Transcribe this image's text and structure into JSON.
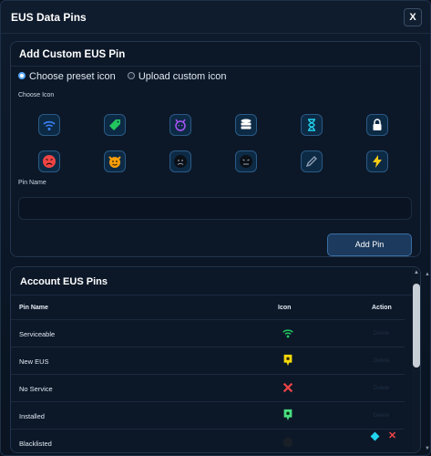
{
  "dialog": {
    "title": "EUS Data Pins",
    "close_label": "X"
  },
  "add_section": {
    "title": "Add Custom EUS Pin",
    "radio_preset": "Choose preset icon",
    "radio_upload": "Upload custom icon",
    "radio_selected": "preset",
    "choose_icon_label": "Choose Icon",
    "pin_name_label": "Pin Name",
    "pin_name_value": "",
    "add_button": "Add Pin",
    "icons": [
      "wifi-icon",
      "tag-icon",
      "devil-icon",
      "database-icon",
      "hourglass-icon",
      "lock-icon",
      "angry-face-icon",
      "cat-face-icon",
      "sad-face-icon",
      "frown-face-icon",
      "pencil-icon",
      "lightning-icon"
    ]
  },
  "list_section": {
    "title": "Account EUS Pins",
    "columns": {
      "name": "Pin Name",
      "icon": "Icon",
      "action": "Action"
    },
    "rows": [
      {
        "name": "Serviceable",
        "icon": "wifi-icon",
        "action": "Delete"
      },
      {
        "name": "New EUS",
        "icon": "pin-icon",
        "action": "Delete"
      },
      {
        "name": "No Service",
        "icon": "x-mark-icon",
        "action": "Delete"
      },
      {
        "name": "Installed",
        "icon": "pin-icon",
        "action": "Delete"
      },
      {
        "name": "Blacklisted",
        "icon": "pin-icon",
        "action": ""
      }
    ]
  },
  "colors": {
    "background": "#0a1220",
    "accent": "#3b6ea3",
    "wifi_green": "#22c55e",
    "yellow_pin": "#f5d90a",
    "red": "#ef4444",
    "green_pin": "#4ade80"
  }
}
